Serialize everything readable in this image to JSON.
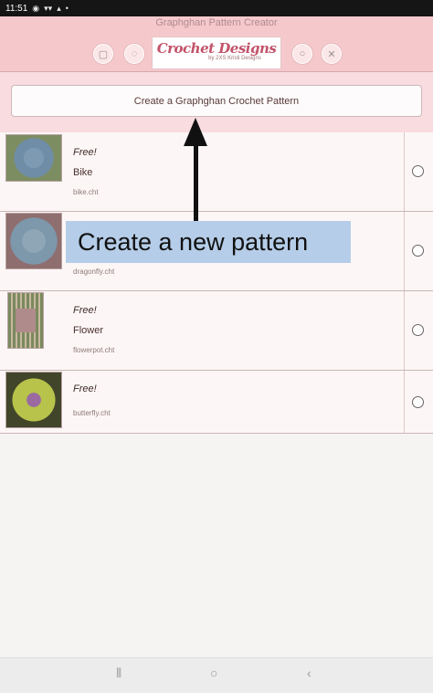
{
  "status_bar": {
    "time": "11:51",
    "icons": [
      "notification-icon",
      "signal-icon",
      "cast-icon",
      "dot-icon"
    ]
  },
  "header": {
    "title": "Graphghan Pattern Creator",
    "logo_text": "Crochet Designs",
    "logo_subtext": "by 2XS Kristi Designs",
    "left_buttons": [
      "folder-icon",
      "chat-icon"
    ],
    "right_buttons": [
      "info-icon",
      "close-icon"
    ]
  },
  "create_button": {
    "label": "Create a Graphghan Crochet Pattern"
  },
  "patterns": [
    {
      "tag": "Free!",
      "name": "Bike",
      "file": "bike.cht",
      "thumb": "bike-thumbnail"
    },
    {
      "tag": "",
      "name": "",
      "file": "dragonfly.cht",
      "thumb": "dragonfly-thumbnail"
    },
    {
      "tag": "Free!",
      "name": "Flower",
      "file": "flowerpot.cht",
      "thumb": "flower-thumbnail"
    },
    {
      "tag": "Free!",
      "name": "",
      "file": "butterfly.cht",
      "thumb": "butterfly-thumbnail"
    }
  ],
  "callout": {
    "text": "Create a new pattern",
    "color": "#b5cde8"
  },
  "nav_bar": {
    "icons": [
      "recents-icon",
      "home-icon",
      "back-icon"
    ]
  },
  "colors": {
    "header_bg": "#f5c9cc",
    "create_area_bg": "#f8dcdf",
    "list_bg": "#fcf7f6"
  }
}
